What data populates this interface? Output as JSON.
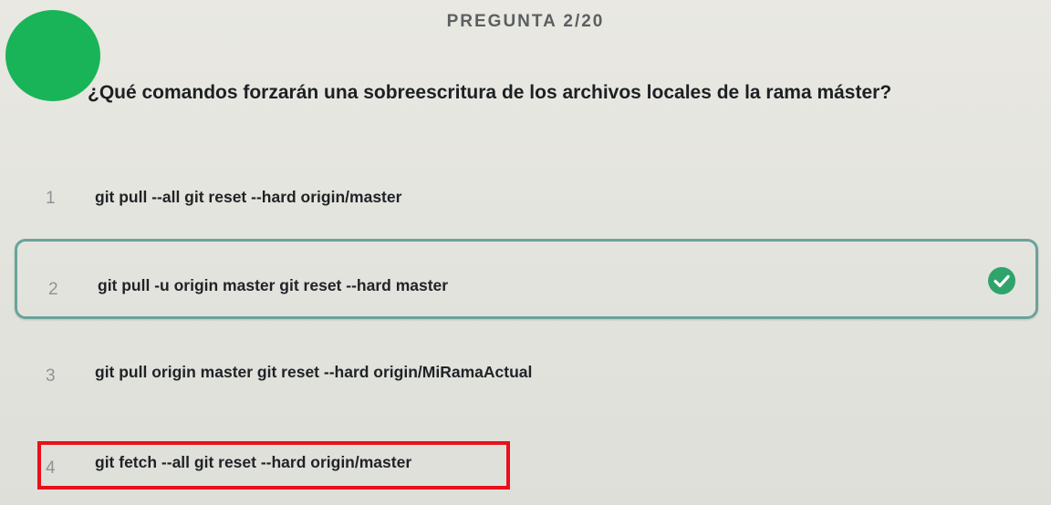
{
  "header": {
    "progress": "PREGUNTA 2/20"
  },
  "question": {
    "text": "¿Qué comandos forzarán una sobreescritura de los archivos locales de la rama máster?"
  },
  "options": [
    {
      "number": "1",
      "text": "git pull --all git reset --hard origin/master",
      "selected": false
    },
    {
      "number": "2",
      "text": "git pull -u origin master git reset --hard master",
      "selected": true
    },
    {
      "number": "3",
      "text": "git pull origin master git reset --hard origin/MiRamaActual",
      "selected": false
    },
    {
      "number": "4",
      "text": "git fetch --all git reset --hard origin/master",
      "selected": false
    }
  ],
  "icons": {
    "selected_check": "check-circle-icon"
  },
  "colors": {
    "avatar": "#19b457",
    "selected_border": "#6aa39a",
    "check": "#2ea46b",
    "annotation": "#e8101a"
  }
}
